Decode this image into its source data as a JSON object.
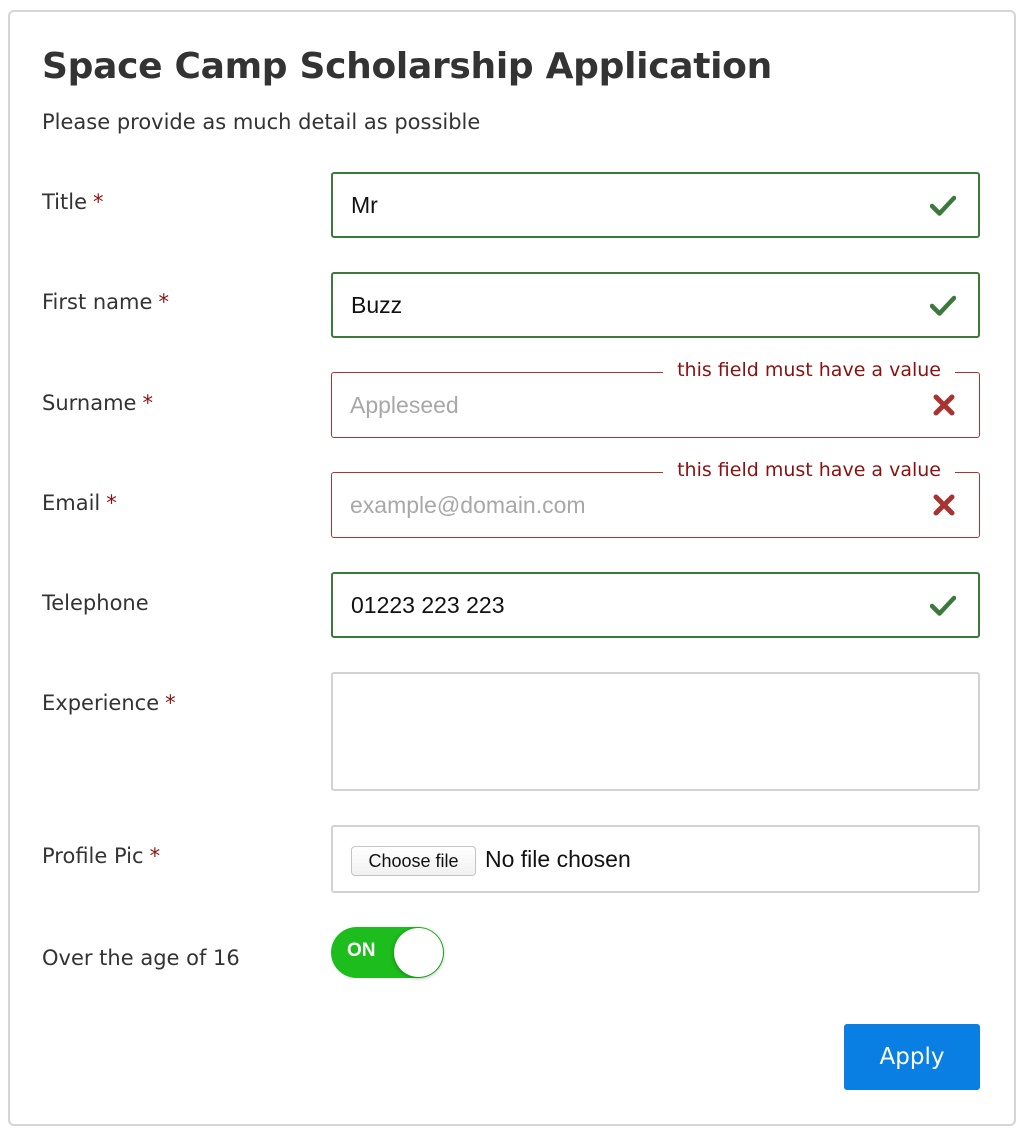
{
  "form": {
    "title": "Space Camp Scholarship Application",
    "subtitle": "Please provide as much detail as possible",
    "required_marker": "*",
    "error_message": "this field must have a value",
    "fields": {
      "title": {
        "label": "Title",
        "value": "Mr",
        "status": "valid"
      },
      "first_name": {
        "label": "First name",
        "value": "Buzz",
        "status": "valid"
      },
      "surname": {
        "label": "Surname",
        "value": "",
        "placeholder": "Appleseed",
        "status": "invalid"
      },
      "email": {
        "label": "Email",
        "value": "",
        "placeholder": "example@domain.com",
        "status": "invalid"
      },
      "telephone": {
        "label": "Telephone",
        "value": "01223 223 223",
        "status": "valid"
      },
      "experience": {
        "label": "Experience",
        "value": ""
      },
      "profile_pic": {
        "label": "Profile Pic",
        "button_label": "Choose file",
        "file_status": "No file chosen"
      },
      "over_16": {
        "label": "Over the age of 16",
        "toggle_text": "ON",
        "checked": true
      }
    },
    "submit_label": "Apply"
  },
  "colors": {
    "valid": "#3c7a3c",
    "invalid": "#a93333",
    "required_marker": "#8b1111",
    "toggle_on": "#1dbd1d",
    "primary_button": "#0a7fe3"
  },
  "icons": {
    "valid": "check-icon",
    "invalid": "cross-icon"
  }
}
